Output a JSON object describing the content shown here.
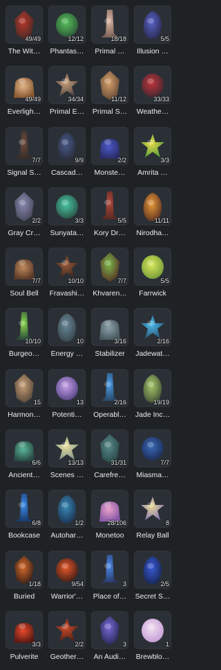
{
  "items": [
    {
      "name": "The Wit…",
      "count": "49/49",
      "icon": "witch-cauldron-icon",
      "c1": "#b8382c",
      "c2": "#4a2a24"
    },
    {
      "name": "Phantas…",
      "count": "12/12",
      "icon": "green-crystal-plant-icon",
      "c1": "#58c25a",
      "c2": "#2f5d3a"
    },
    {
      "name": "Primal …",
      "count": "18/18",
      "icon": "primal-obelisk-icon",
      "c1": "#d8b6a3",
      "c2": "#7c6258"
    },
    {
      "name": "Illusion …",
      "count": "5/5",
      "icon": "illusion-crystal-icon",
      "c1": "#5a63c9",
      "c2": "#2c2e57"
    },
    {
      "name": "Everligh…",
      "count": "49/49",
      "icon": "everlight-arch-icon",
      "c1": "#e3b88a",
      "c2": "#8b5a32"
    },
    {
      "name": "Primal E…",
      "count": "34/34",
      "icon": "primal-shrine-icon",
      "c1": "#c8a07a",
      "c2": "#5a4a46"
    },
    {
      "name": "Primal S…",
      "count": "11/12",
      "icon": "primal-hourglass-icon",
      "c1": "#d8a06a",
      "c2": "#6b4f3a"
    },
    {
      "name": "Weathe…",
      "count": "33/33",
      "icon": "weather-stone-icon",
      "c1": "#c0343c",
      "c2": "#4a2830"
    },
    {
      "name": "Signal S…",
      "count": "7/7",
      "icon": "signal-station-icon",
      "c1": "#6a4c3c",
      "c2": "#3a2d28"
    },
    {
      "name": "Cascad…",
      "count": "9/9",
      "icon": "cascade-cube-icon",
      "c1": "#4a5a8a",
      "c2": "#2a2e3e"
    },
    {
      "name": "Monste…",
      "count": "2/2",
      "icon": "monster-creature-icon",
      "c1": "#4a58c8",
      "c2": "#2a2e68"
    },
    {
      "name": "Amrita …",
      "count": "3/3",
      "icon": "amrita-flower-icon",
      "c1": "#e8d84a",
      "c2": "#5aa03a"
    },
    {
      "name": "Gray Cr…",
      "count": "2/2",
      "icon": "gray-crystal-rock-icon",
      "c1": "#8a8ab0",
      "c2": "#4a4a60"
    },
    {
      "name": "Sunyata…",
      "count": "3/3",
      "icon": "sunyata-flower-icon",
      "c1": "#4ac8a8",
      "c2": "#2a5a4a"
    },
    {
      "name": "Kory Dr…",
      "count": "5/5",
      "icon": "kory-drum-stump-icon",
      "c1": "#b0483a",
      "c2": "#5a2a24"
    },
    {
      "name": "Nirodha…",
      "count": "11/11",
      "icon": "nirodha-fruit-icon",
      "c1": "#e89a3a",
      "c2": "#6a3a24"
    },
    {
      "name": "Soul Bell",
      "count": "7/7",
      "icon": "soul-bell-icon",
      "c1": "#c08a5a",
      "c2": "#5a3a28"
    },
    {
      "name": "Fravashi…",
      "count": "10/10",
      "icon": "fravashi-tree-icon",
      "c1": "#9a5a3a",
      "c2": "#3a2820"
    },
    {
      "name": "Khvaren…",
      "count": "7/7",
      "icon": "khvarenah-stump-icon",
      "c1": "#7ab84a",
      "c2": "#5a3a28"
    },
    {
      "name": "Farrwick",
      "count": "5/5",
      "icon": "farrwick-sprout-icon",
      "c1": "#d8e85a",
      "c2": "#7aa03a"
    },
    {
      "name": "Burgeo…",
      "count": "10/10",
      "icon": "burgeoning-orb-icon",
      "c1": "#8ad84a",
      "c2": "#2a4a3a"
    },
    {
      "name": "Energy …",
      "count": "10",
      "icon": "energy-fountain-icon",
      "c1": "#6a8a9a",
      "c2": "#3a4a52"
    },
    {
      "name": "Stabilizer",
      "count": "3/16",
      "icon": "stabilizer-pillar-icon",
      "c1": "#8aa0a8",
      "c2": "#4a5a60"
    },
    {
      "name": "Jadewat…",
      "count": "2/16",
      "icon": "jadewater-bulb-icon",
      "c1": "#4ab8e8",
      "c2": "#2a5a7a"
    },
    {
      "name": "Harmon…",
      "count": "15",
      "icon": "harmonic-pipes-icon",
      "c1": "#c8a07a",
      "c2": "#5a4a3a"
    },
    {
      "name": "Potenti…",
      "count": "13",
      "icon": "potential-swirl-icon",
      "c1": "#c8a0e8",
      "c2": "#5a4a8a"
    },
    {
      "name": "Operabl…",
      "count": "2/16",
      "icon": "operable-lamp-icon",
      "c1": "#4a9ae8",
      "c2": "#2a4a6a"
    },
    {
      "name": "Jade Inc…",
      "count": "19/19",
      "icon": "jade-incense-burner-icon",
      "c1": "#a8c86a",
      "c2": "#4a5a3a"
    },
    {
      "name": "Ancient…",
      "count": "6/6",
      "icon": "ancient-stele-icon",
      "c1": "#5ab89a",
      "c2": "#2a4a44"
    },
    {
      "name": "Scenes …",
      "count": "13/13",
      "icon": "scenes-lotus-icon",
      "c1": "#e8e0a0",
      "c2": "#8a9a8a"
    },
    {
      "name": "Carefre…",
      "count": "31/31",
      "icon": "carefree-stone-urn-icon",
      "c1": "#5a8a8a",
      "c2": "#2a4a4a"
    },
    {
      "name": "Miasma…",
      "count": "7/7",
      "icon": "miasma-tendril-icon",
      "c1": "#3a6ab8",
      "c2": "#1e2e58"
    },
    {
      "name": "Bookcase",
      "count": "6/8",
      "icon": "bookcase-tower-icon",
      "c1": "#3a8ae8",
      "c2": "#1a3a6a"
    },
    {
      "name": "Autohar…",
      "count": "1/2",
      "icon": "autoharp-spire-icon",
      "c1": "#3a8ab8",
      "c2": "#1e3a5a"
    },
    {
      "name": "Monetoo",
      "count": "28/106",
      "icon": "monetoo-blob-icon",
      "c1": "#e8a0c8",
      "c2": "#8a5aa8"
    },
    {
      "name": "Relay Ball",
      "count": "8",
      "icon": "relay-ball-icon",
      "c1": "#e8d890",
      "c2": "#8a7ab8"
    },
    {
      "name": "Buried",
      "count": "1/18",
      "icon": "buried-ring-icon",
      "c1": "#d86a2a",
      "c2": "#3a2218"
    },
    {
      "name": "Warrior'…",
      "count": "9/54",
      "icon": "warrior-emblem-icon",
      "c1": "#e8582a",
      "c2": "#4a2218"
    },
    {
      "name": "Place of…",
      "count": "3",
      "icon": "place-of-portal-icon",
      "c1": "#4a8ae8",
      "c2": "#2a3a6a"
    },
    {
      "name": "Secret S…",
      "count": "2/5",
      "icon": "secret-shrine-icon",
      "c1": "#3a5ad8",
      "c2": "#1a2a5a"
    },
    {
      "name": "Pulverite",
      "count": "3/3",
      "icon": "pulverite-rock-icon",
      "c1": "#e84a2a",
      "c2": "#5a1a14"
    },
    {
      "name": "Geother…",
      "count": "2/2",
      "icon": "geothermal-rock-icon",
      "c1": "#c84a2a",
      "c2": "#5a2418"
    },
    {
      "name": "An Audi…",
      "count": "3",
      "icon": "audience-crystal-icon",
      "c1": "#7a6ad8",
      "c2": "#2a2a5a"
    },
    {
      "name": "Brewblo…",
      "count": "1",
      "icon": "brewbloom-flower-icon",
      "c1": "#f0e0f0",
      "c2": "#c8a0d8"
    }
  ]
}
